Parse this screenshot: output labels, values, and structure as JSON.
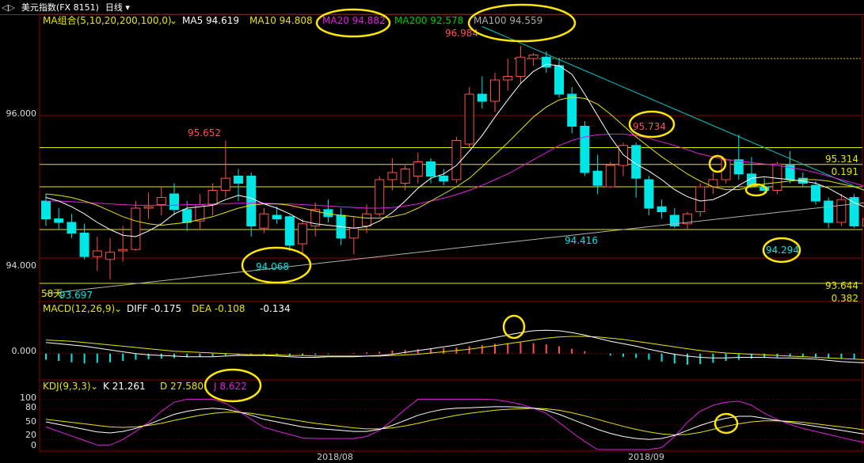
{
  "header": {
    "nav_glyph": "◁▷",
    "instrument": "美元指数(FX 8151)",
    "period": "日线"
  },
  "colors": {
    "up": "#ff5050",
    "down": "#00e5e5",
    "ma5": "#ffffff",
    "ma10": "#e6e600",
    "ma20": "#e020e0",
    "ma200": "#00cc00",
    "ma100": "#aaaaaa",
    "dif": "#ffffff",
    "dea": "#e6e600",
    "k": "#ffffff",
    "d": "#e6e600",
    "j": "#e020e0",
    "trend": "#00cccc",
    "level": "#e6e600",
    "grid": "#8b0000",
    "highlight": "#ffe800"
  },
  "main_legend": {
    "indicator": "MA组合(5,10,20,200,100,0)",
    "ma5": "MA5 94.619",
    "ma10": "MA10 94.808",
    "ma20": "MA20 94.882",
    "ma200": "MA200 92.578",
    "ma100": "MA100 94.559"
  },
  "macd_legend": {
    "indicator": "MACD(12,26,9)",
    "diff": "DIFF -0.175",
    "dea": "DEA -0.108",
    "macd": "-0.134"
  },
  "kdj_legend": {
    "indicator": "KDJ(9,3,3)",
    "k": "K 21.261",
    "d": "D 27.580",
    "j": "J 8.622"
  },
  "annotations": {
    "high": "96.984",
    "peak1": "95.652",
    "peak2": "95.734",
    "low1": "93.697",
    "low2": "94.068",
    "low3": "94.416",
    "low4": "94.294",
    "level_upper": "95.314",
    "ratio_upper": "0.191",
    "level_lower": "93.644",
    "ratio_lower": "0.382",
    "days": "58天"
  },
  "chart_data": [
    {
      "type": "candlestick",
      "panel": "price",
      "y_ticks": [
        "96.000",
        "94.000"
      ],
      "ylim": [
        93.4,
        97.2
      ],
      "x_ticks": [
        "2018/08",
        "2018/09"
      ],
      "ohlc": [
        [
          94.8,
          94.9,
          94.45,
          94.55
        ],
        [
          94.55,
          94.7,
          94.4,
          94.5
        ],
        [
          94.5,
          94.62,
          94.28,
          94.35
        ],
        [
          94.35,
          94.48,
          93.98,
          94.02
        ],
        [
          94.02,
          94.3,
          93.82,
          94.1
        ],
        [
          93.98,
          94.28,
          93.7,
          94.08
        ],
        [
          94.1,
          94.45,
          93.95,
          94.12
        ],
        [
          94.12,
          94.8,
          94.1,
          94.7
        ],
        [
          94.7,
          94.92,
          94.55,
          94.72
        ],
        [
          94.75,
          95.0,
          94.6,
          94.85
        ],
        [
          94.9,
          95.05,
          94.6,
          94.68
        ],
        [
          94.68,
          94.8,
          94.38,
          94.5
        ],
        [
          94.52,
          94.9,
          94.4,
          94.75
        ],
        [
          94.75,
          95.05,
          94.6,
          94.95
        ],
        [
          94.95,
          95.65,
          94.85,
          95.12
        ],
        [
          95.15,
          95.25,
          94.8,
          95.05
        ],
        [
          95.15,
          95.2,
          94.3,
          94.45
        ],
        [
          94.42,
          94.7,
          94.35,
          94.62
        ],
        [
          94.6,
          94.72,
          94.48,
          94.55
        ],
        [
          94.58,
          94.6,
          94.1,
          94.18
        ],
        [
          94.2,
          94.55,
          94.05,
          94.48
        ],
        [
          94.45,
          94.78,
          94.3,
          94.68
        ],
        [
          94.68,
          94.82,
          94.5,
          94.58
        ],
        [
          94.6,
          94.7,
          94.18,
          94.28
        ],
        [
          94.28,
          94.58,
          94.05,
          94.42
        ],
        [
          94.45,
          94.75,
          94.35,
          94.62
        ],
        [
          94.62,
          95.15,
          94.58,
          95.1
        ],
        [
          95.1,
          95.4,
          94.95,
          95.2
        ],
        [
          95.05,
          95.3,
          94.95,
          95.25
        ],
        [
          95.15,
          95.48,
          95.05,
          95.35
        ],
        [
          95.35,
          95.4,
          95.05,
          95.15
        ],
        [
          95.15,
          95.25,
          95.02,
          95.08
        ],
        [
          95.1,
          95.7,
          95.05,
          95.65
        ],
        [
          95.6,
          96.4,
          95.55,
          96.3
        ],
        [
          96.3,
          96.55,
          96.1,
          96.2
        ],
        [
          96.2,
          96.6,
          96.05,
          96.5
        ],
        [
          96.5,
          96.8,
          96.35,
          96.55
        ],
        [
          96.55,
          96.98,
          96.45,
          96.82
        ],
        [
          96.8,
          96.88,
          96.7,
          96.85
        ],
        [
          96.82,
          96.9,
          96.6,
          96.68
        ],
        [
          96.7,
          96.78,
          96.25,
          96.3
        ],
        [
          96.3,
          96.4,
          95.75,
          95.85
        ],
        [
          95.85,
          95.92,
          95.15,
          95.2
        ],
        [
          95.22,
          95.45,
          94.9,
          95.02
        ],
        [
          95.0,
          95.35,
          94.98,
          95.3
        ],
        [
          95.3,
          95.62,
          95.15,
          95.58
        ],
        [
          95.58,
          95.62,
          94.85,
          95.12
        ],
        [
          95.1,
          95.15,
          94.6,
          94.7
        ],
        [
          94.72,
          94.82,
          94.55,
          94.65
        ],
        [
          94.6,
          94.7,
          94.42,
          94.45
        ],
        [
          94.48,
          94.65,
          94.4,
          94.62
        ],
        [
          94.65,
          95.05,
          94.58,
          95.0
        ],
        [
          95.0,
          95.2,
          94.9,
          95.1
        ],
        [
          95.1,
          95.4,
          95.05,
          95.38
        ],
        [
          95.38,
          95.73,
          95.1,
          95.18
        ],
        [
          95.18,
          95.42,
          94.98,
          95.02
        ],
        [
          95.0,
          95.12,
          94.9,
          94.95
        ],
        [
          94.95,
          95.35,
          94.9,
          95.32
        ],
        [
          95.3,
          95.5,
          95.05,
          95.1
        ],
        [
          95.12,
          95.2,
          95.0,
          95.05
        ],
        [
          95.02,
          95.08,
          94.75,
          94.8
        ],
        [
          94.8,
          94.85,
          94.42,
          94.5
        ],
        [
          94.5,
          94.9,
          94.45,
          94.82
        ],
        [
          94.85,
          94.9,
          94.42,
          94.45
        ],
        [
          94.45,
          94.6,
          94.3,
          94.55
        ],
        [
          94.62,
          94.7,
          94.29,
          94.52
        ],
        [
          94.52,
          94.58,
          94.45,
          94.48
        ]
      ],
      "ma5": [
        94.85,
        94.8,
        94.72,
        94.62,
        94.5,
        94.4,
        94.32,
        94.3,
        94.38,
        94.48,
        94.62,
        94.7,
        94.72,
        94.74,
        94.82,
        94.88,
        94.84,
        94.76,
        94.7,
        94.62,
        94.52,
        94.48,
        94.46,
        94.44,
        94.42,
        94.44,
        94.52,
        94.64,
        94.8,
        94.98,
        95.12,
        95.18,
        95.3,
        95.5,
        95.72,
        95.98,
        96.22,
        96.45,
        96.62,
        96.72,
        96.7,
        96.58,
        96.3,
        96.0,
        95.7,
        95.45,
        95.32,
        95.22,
        95.1,
        94.96,
        94.86,
        94.8,
        94.82,
        94.9,
        95.02,
        95.12,
        95.14,
        95.12,
        95.1,
        95.08,
        95.05,
        94.98,
        94.88,
        94.78,
        94.7,
        94.64,
        94.6
      ],
      "ma10": [
        94.9,
        94.88,
        94.85,
        94.8,
        94.74,
        94.66,
        94.58,
        94.52,
        94.48,
        94.46,
        94.48,
        94.5,
        94.54,
        94.58,
        94.64,
        94.7,
        94.74,
        94.76,
        94.76,
        94.74,
        94.7,
        94.66,
        94.62,
        94.6,
        94.58,
        94.56,
        94.56,
        94.58,
        94.62,
        94.7,
        94.8,
        94.9,
        95.0,
        95.12,
        95.28,
        95.45,
        95.62,
        95.8,
        95.98,
        96.12,
        96.22,
        96.26,
        96.24,
        96.16,
        96.02,
        95.86,
        95.7,
        95.56,
        95.42,
        95.3,
        95.18,
        95.08,
        95.0,
        94.96,
        94.96,
        95.0,
        95.04,
        95.06,
        95.08,
        95.1,
        95.1,
        95.08,
        95.04,
        95.0,
        94.94,
        94.88,
        94.82
      ],
      "ma20": [
        94.8,
        94.8,
        94.79,
        94.78,
        94.77,
        94.76,
        94.75,
        94.74,
        94.74,
        94.74,
        94.74,
        94.75,
        94.75,
        94.76,
        94.76,
        94.77,
        94.77,
        94.77,
        94.76,
        94.76,
        94.75,
        94.74,
        94.73,
        94.72,
        94.71,
        94.7,
        94.7,
        94.71,
        94.73,
        94.76,
        94.8,
        94.84,
        94.89,
        94.95,
        95.02,
        95.1,
        95.18,
        95.28,
        95.38,
        95.48,
        95.58,
        95.65,
        95.7,
        95.73,
        95.74,
        95.74,
        95.72,
        95.68,
        95.63,
        95.58,
        95.52,
        95.46,
        95.42,
        95.38,
        95.36,
        95.34,
        95.32,
        95.3,
        95.27,
        95.24,
        95.2,
        95.15,
        95.1,
        95.05,
        95.0,
        94.94,
        94.88
      ],
      "ma200": [
        93.5,
        93.52,
        93.54,
        93.56,
        93.58,
        93.6,
        93.62,
        93.64,
        93.66,
        93.68,
        93.7,
        93.72,
        93.74,
        93.76,
        93.78,
        93.8,
        93.82,
        93.84,
        93.86,
        93.88,
        93.9,
        93.92,
        93.94,
        93.96,
        93.98,
        94.0,
        94.02,
        94.04,
        94.06,
        94.08,
        94.1,
        94.12,
        94.14,
        94.16,
        94.18,
        94.2,
        94.22,
        94.24,
        94.26,
        94.28,
        94.3,
        94.32,
        94.34,
        94.36,
        94.38,
        94.4,
        94.42,
        94.44,
        94.46,
        94.48,
        94.5,
        94.52,
        94.54,
        94.56,
        94.58,
        94.6,
        94.62,
        94.64,
        94.66,
        94.68,
        94.7,
        94.72,
        94.74,
        94.76,
        94.78,
        94.8,
        94.82
      ],
      "levels": [
        95.55,
        95.314,
        95.0,
        94.4,
        93.644
      ],
      "trendline": [
        [
          34,
          97.25
        ],
        [
          67,
          94.7
        ]
      ]
    },
    {
      "type": "bar",
      "panel": "macd",
      "y_ticks": [
        "0.000"
      ],
      "ylim": [
        -0.4,
        0.6
      ],
      "hist": [
        -0.1,
        -0.12,
        -0.14,
        -0.16,
        -0.15,
        -0.14,
        -0.12,
        -0.1,
        -0.09,
        -0.08,
        -0.07,
        -0.06,
        -0.05,
        -0.04,
        -0.03,
        -0.02,
        -0.02,
        -0.03,
        -0.03,
        -0.04,
        -0.03,
        -0.02,
        -0.01,
        0.0,
        0.01,
        0.02,
        0.03,
        0.05,
        0.06,
        0.07,
        0.08,
        0.09,
        0.1,
        0.12,
        0.14,
        0.16,
        0.17,
        0.18,
        0.17,
        0.15,
        0.12,
        0.08,
        0.04,
        0.0,
        -0.03,
        -0.05,
        -0.07,
        -0.1,
        -0.13,
        -0.16,
        -0.18,
        -0.17,
        -0.15,
        -0.12,
        -0.1,
        -0.08,
        -0.07,
        -0.06,
        -0.05,
        -0.05,
        -0.06,
        -0.07,
        -0.08,
        -0.09,
        -0.1,
        -0.12,
        -0.13
      ],
      "dif": [
        0.18,
        0.16,
        0.14,
        0.12,
        0.09,
        0.06,
        0.03,
        0.0,
        -0.02,
        -0.03,
        -0.04,
        -0.05,
        -0.05,
        -0.05,
        -0.04,
        -0.03,
        -0.03,
        -0.03,
        -0.04,
        -0.05,
        -0.06,
        -0.06,
        -0.05,
        -0.05,
        -0.05,
        -0.04,
        -0.03,
        -0.01,
        0.02,
        0.05,
        0.08,
        0.11,
        0.14,
        0.18,
        0.22,
        0.26,
        0.3,
        0.34,
        0.37,
        0.38,
        0.37,
        0.34,
        0.3,
        0.25,
        0.2,
        0.16,
        0.12,
        0.07,
        0.03,
        -0.01,
        -0.04,
        -0.06,
        -0.07,
        -0.07,
        -0.06,
        -0.06,
        -0.06,
        -0.07,
        -0.07,
        -0.08,
        -0.09,
        -0.11,
        -0.13,
        -0.14,
        -0.15,
        -0.16,
        -0.175
      ],
      "dea": [
        0.22,
        0.21,
        0.2,
        0.18,
        0.16,
        0.14,
        0.12,
        0.1,
        0.08,
        0.06,
        0.04,
        0.03,
        0.02,
        0.01,
        0.0,
        -0.01,
        -0.02,
        -0.02,
        -0.02,
        -0.03,
        -0.03,
        -0.04,
        -0.04,
        -0.04,
        -0.04,
        -0.04,
        -0.04,
        -0.03,
        -0.02,
        -0.01,
        0.01,
        0.03,
        0.05,
        0.07,
        0.1,
        0.13,
        0.16,
        0.19,
        0.22,
        0.25,
        0.27,
        0.28,
        0.28,
        0.27,
        0.25,
        0.23,
        0.2,
        0.17,
        0.14,
        0.11,
        0.08,
        0.05,
        0.03,
        0.01,
        0.0,
        -0.01,
        -0.02,
        -0.03,
        -0.04,
        -0.05,
        -0.06,
        -0.07,
        -0.08,
        -0.09,
        -0.1,
        -0.105,
        -0.108
      ]
    },
    {
      "type": "line",
      "panel": "kdj",
      "y_ticks": [
        "100",
        "80",
        "50",
        "20",
        "0"
      ],
      "ylim": [
        0,
        110
      ],
      "k": [
        55,
        50,
        45,
        40,
        35,
        33,
        36,
        42,
        50,
        60,
        70,
        76,
        80,
        82,
        80,
        75,
        68,
        60,
        55,
        50,
        45,
        42,
        40,
        38,
        36,
        36,
        40,
        48,
        58,
        68,
        75,
        80,
        82,
        83,
        84,
        85,
        85,
        84,
        82,
        78,
        70,
        60,
        50,
        40,
        32,
        26,
        22,
        20,
        22,
        28,
        38,
        48,
        56,
        62,
        66,
        66,
        62,
        58,
        54,
        50,
        46,
        42,
        38,
        34,
        30,
        26,
        21
      ],
      "d": [
        60,
        57,
        54,
        51,
        48,
        45,
        44,
        45,
        48,
        52,
        58,
        63,
        68,
        72,
        74,
        74,
        72,
        68,
        64,
        60,
        56,
        52,
        49,
        46,
        43,
        41,
        41,
        43,
        47,
        52,
        58,
        63,
        68,
        72,
        75,
        78,
        80,
        81,
        82,
        81,
        78,
        73,
        67,
        60,
        53,
        46,
        40,
        35,
        31,
        29,
        30,
        34,
        40,
        46,
        51,
        55,
        57,
        57,
        56,
        54,
        51,
        48,
        45,
        42,
        38,
        33,
        27.58
      ],
      "j": [
        45,
        36,
        27,
        18,
        9,
        9,
        20,
        36,
        54,
        76,
        94,
        100,
        100,
        100,
        92,
        77,
        60,
        44,
        37,
        30,
        23,
        22,
        22,
        22,
        22,
        26,
        38,
        58,
        80,
        100,
        100,
        100,
        100,
        100,
        100,
        99,
        95,
        90,
        82,
        72,
        54,
        34,
        16,
        0,
        0,
        0,
        0,
        0,
        4,
        26,
        54,
        76,
        88,
        94,
        96,
        88,
        72,
        60,
        50,
        42,
        36,
        30,
        24,
        18,
        14,
        12,
        8.622
      ]
    }
  ]
}
